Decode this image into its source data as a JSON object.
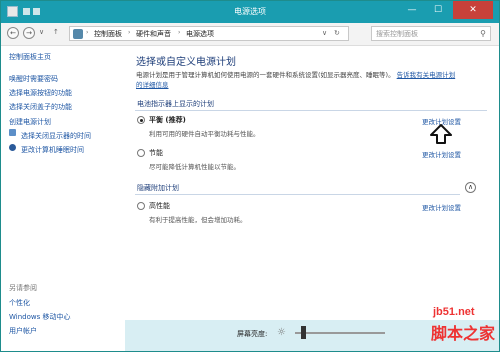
{
  "window": {
    "title": "电源选项",
    "controls": {
      "minimize": "—",
      "maximize": "☐",
      "close": "✕"
    }
  },
  "navbar": {
    "back": "←",
    "forward": "→",
    "dropdown": "∨",
    "up": "↑",
    "breadcrumbs": [
      "控制面板",
      "硬件和声音",
      "电源选项"
    ],
    "breadcrumb_sep": "›",
    "refresh": "↻",
    "search_placeholder": "搜索控制面板"
  },
  "sidebar": {
    "home": "控制面板主页",
    "items": [
      "唤醒时需要密码",
      "选择电源按钮的功能",
      "选择关闭盖子的功能",
      "创建电源计划",
      "选择关闭显示器的时间",
      "更改计算机睡眠时间"
    ],
    "see_also_title": "另请参阅",
    "see_also": [
      "个性化",
      "Windows 移动中心",
      "用户帐户"
    ]
  },
  "main": {
    "heading": "选择或自定义电源计划",
    "description": "电源计划是用于管理计算机如何使用电源的一套硬件和系统设置(如显示器亮度、睡眠等)。",
    "description_link_1": "告诉我有关电源计划",
    "description_link_2": "的详细信息",
    "section_shown": "电池指示器上显示的计划",
    "section_hidden": "隐藏附加计划",
    "plans": [
      {
        "name": "平衡 (推荐)",
        "desc": "利用可用的硬件自动平衡功耗与性能。",
        "selected": true,
        "change": "更改计划设置"
      },
      {
        "name": "节能",
        "desc": "尽可能降低计算机性能以节能。",
        "selected": false,
        "change": "更改计划设置"
      },
      {
        "name": "高性能",
        "desc": "有利于提高性能，但会增加功耗。",
        "selected": false,
        "change": "更改计划设置"
      }
    ],
    "collapse": "∧"
  },
  "bottom": {
    "brightness_label": "屏幕亮度:",
    "brightness_icon": "☼"
  },
  "watermark": {
    "url": "jb51.net",
    "text": "脚本之家"
  },
  "colors": {
    "titlebar": "#1a9db0",
    "link": "#1f57a4",
    "heading": "#1e3e7a",
    "bottom_bar": "#d8eef3",
    "watermark": "#e33333"
  }
}
